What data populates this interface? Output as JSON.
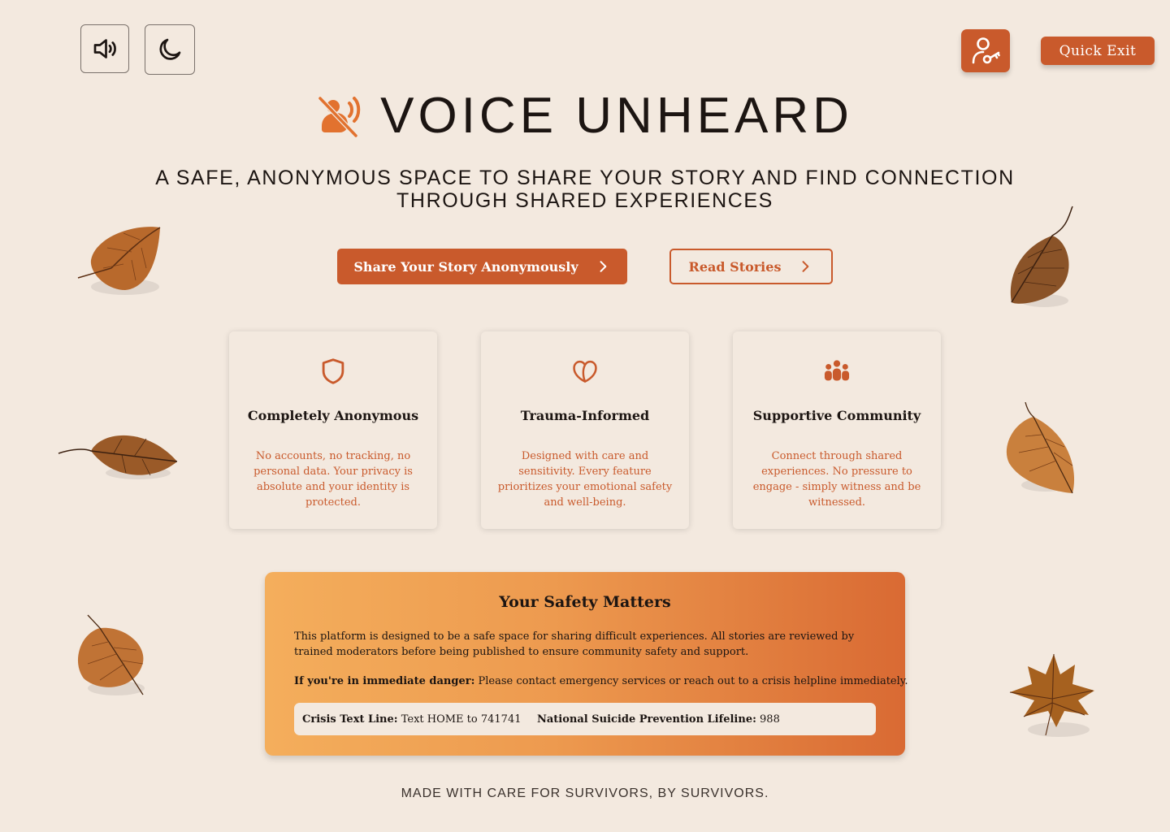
{
  "toolbar": {
    "sound_icon": "volume-icon",
    "theme_icon": "moon-icon",
    "account_icon": "user-key-icon",
    "quick_exit_label": "Quick Exit"
  },
  "hero": {
    "logo_icon": "muted-speech-icon",
    "title": "VOICE UNHEARD",
    "tagline": "A SAFE, ANONYMOUS SPACE TO SHARE YOUR STORY AND FIND CONNECTION THROUGH SHARED EXPERIENCES"
  },
  "actions": {
    "share_label": "Share Your Story Anonymously",
    "read_label": "Read Stories"
  },
  "features": [
    {
      "icon": "shield-icon",
      "title": "Completely Anonymous",
      "body": "No accounts, no tracking, no personal data. Your privacy is absolute and your identity is protected."
    },
    {
      "icon": "heart-icon",
      "title": "Trauma-Informed",
      "body": "Designed with care and sensitivity. Every feature prioritizes your emotional safety and well-being."
    },
    {
      "icon": "community-icon",
      "title": "Supportive Community",
      "body": "Connect through shared experiences. No pressure to engage - simply witness and be witnessed."
    }
  ],
  "safety": {
    "title": "Your Safety Matters",
    "body": "This platform is designed to be a safe space for sharing difficult experiences. All stories are reviewed by trained moderators before being published to ensure community safety and support.",
    "danger_label": "If you're in immediate danger:",
    "danger_text": " Please contact emergency services or reach out to a crisis helpline immediately.",
    "crisis_label": "Crisis Text Line:",
    "crisis_value": " Text HOME to 741741",
    "lifeline_label": "National Suicide Prevention Lifeline:",
    "lifeline_value": " 988"
  },
  "footer": {
    "text": "MADE WITH CARE FOR SURVIVORS, BY SURVIVORS."
  },
  "colors": {
    "background": "#f3e9df",
    "accent": "#c95a2c",
    "gradient_start": "#f4ae5c",
    "gradient_end": "#d96a33"
  }
}
